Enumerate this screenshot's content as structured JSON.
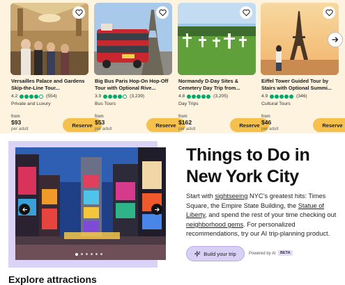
{
  "tours": [
    {
      "title": "Versailles Palace and Gardens Skip-the-Line Tour...",
      "rating": "4.2",
      "dots": 4,
      "reviews": "(554)",
      "category": "Private and Luxury",
      "from": "from",
      "price": "$93",
      "unit": "per adult",
      "reserve": "Reserve",
      "image_icon": "versailles-hall"
    },
    {
      "title": "Big Bus Paris Hop-On Hop-Off Tour with Optional Rive...",
      "rating": "3.9",
      "dots": 4,
      "reviews": "(3,239)",
      "category": "Bus Tours",
      "from": "from",
      "price": "$53",
      "unit": "per adult",
      "reserve": "Reserve",
      "image_icon": "red-double-decker-bus"
    },
    {
      "title": "Normandy D-Day Sites & Cemetery Day Trip from...",
      "rating": "4.8",
      "dots": 5,
      "reviews": "(3,205)",
      "category": "Day Trips",
      "from": "from",
      "price": "$162",
      "unit": "per adult",
      "reserve": "Reserve",
      "image_icon": "cemetery-crosses"
    },
    {
      "title": "Eiffel Tower Guided Tour by Stairs with Optional Summi...",
      "rating": "4.9",
      "dots": 5,
      "reviews": "(346)",
      "category": "Cultural Tours",
      "from": "from",
      "price": "$46",
      "unit": "per adult",
      "reserve": "Reserve",
      "image_icon": "eiffel-tower"
    }
  ],
  "hero": {
    "title": "Things to Do in New York City",
    "text_before_1": "Start with ",
    "link_1": "sightseeing",
    "text_before_2": " NYC’s greatest hits: Times Square, the Empire State Building, the ",
    "link_2": "Statue of Liberty",
    "text_before_3": ", and spend the rest of your time checking out ",
    "link_3": "neighborhood gems",
    "text_after": ". For personalized recommendations, try our AI trip-planning product.",
    "build_button": "Build your trip",
    "powered_by": "Powered by AI",
    "beta": "BETA",
    "image_icon": "times-square",
    "pager_count": 6,
    "pager_active": 0
  },
  "next_section_title": "Explore attractions",
  "colors": {
    "strip_bg": "#fdf3de",
    "reserve": "#f5c14c",
    "rating_green": "#00aa6c",
    "hero_frame": "#dbd2f7",
    "build_button": "#d9d0f6"
  }
}
